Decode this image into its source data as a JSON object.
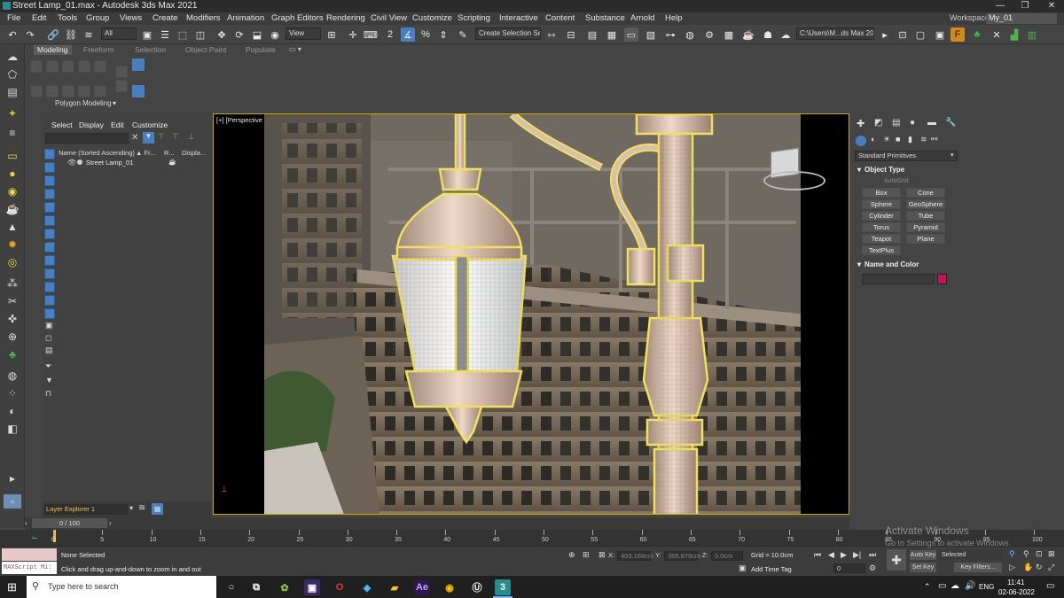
{
  "window": {
    "title": "Street Lamp_01.max - Autodesk 3ds Max 2021",
    "minimize": "—",
    "maximize": "❐",
    "close": "✕"
  },
  "menu": [
    "File",
    "Edit",
    "Tools",
    "Group",
    "Views",
    "Create",
    "Modifiers",
    "Animation",
    "Graph Editors",
    "Rendering",
    "Civil View",
    "Customize",
    "Scripting",
    "Interactive",
    "Content",
    "Substance",
    "Arnold",
    "Help"
  ],
  "workspace": {
    "label": "Workspaces:",
    "value": "My_01"
  },
  "toolbar": {
    "selection_filter": "All",
    "ref_coord": "View",
    "selection_set": "Create Selection Se",
    "project_path": "C:\\Users\\M...ds Max 202"
  },
  "ribbon": {
    "tabs": [
      "Modeling",
      "Freeform",
      "Selection",
      "Object Paint",
      "Populate"
    ],
    "panel": "Polygon Modeling"
  },
  "scene_explorer": {
    "tabs": [
      "Select",
      "Display",
      "Edit",
      "Customize"
    ],
    "columns": [
      "Name (Sorted Ascending)",
      "▲ Fr...",
      "R...",
      "Displa..."
    ],
    "rows": [
      {
        "name": "Street Lamp_01"
      }
    ],
    "layer_explorer": "Layer Explorer 1"
  },
  "viewport": {
    "label": "[+] [Perspective ] [Standard ] [Edged Faces ]"
  },
  "command_panel": {
    "category": "Standard Primitives",
    "object_type_title": "Object Type",
    "autogrid": "AutoGrid",
    "buttons": [
      "Box",
      "Cone",
      "Sphere",
      "GeoSphere",
      "Cylinder",
      "Tube",
      "Torus",
      "Pyramid",
      "Teapot",
      "Plane",
      "TextPlus"
    ],
    "name_color_title": "Name and Color",
    "swatch": "#c2185b"
  },
  "timeline": {
    "frame": "0 / 100",
    "ticks": [
      "0",
      "5",
      "10",
      "15",
      "20",
      "25",
      "30",
      "35",
      "40",
      "45",
      "50",
      "55",
      "60",
      "65",
      "70",
      "75",
      "80",
      "85",
      "90",
      "95",
      "100"
    ]
  },
  "status": {
    "maxscript": "MAXScript Mi:",
    "selection": "None Selected",
    "prompt": "Click and drag up-and-down to zoom in and out",
    "x_label": "X:",
    "x": "403.168cm",
    "y_label": "Y:",
    "y": "355.879cm",
    "z_label": "Z:",
    "z": "0.0cm",
    "grid": "Grid = 10.0cm",
    "add_time_tag": "Add Time Tag",
    "auto_key": "Auto Key",
    "set_key": "Set Key",
    "key_mode": "Selected",
    "key_filters": "Key Filters...",
    "frame_counter": "0"
  },
  "watermark": {
    "title": "Activate Windows",
    "subtitle": "Go to Settings to activate Windows."
  },
  "taskbar": {
    "search": "Type here to search",
    "lang": "ENG",
    "time": "11:41",
    "date": "02-06-2022"
  },
  "colors": {
    "selection_outline": "#f0e060",
    "active_tool": "#4a7fbf",
    "accent": "#c8a800"
  }
}
